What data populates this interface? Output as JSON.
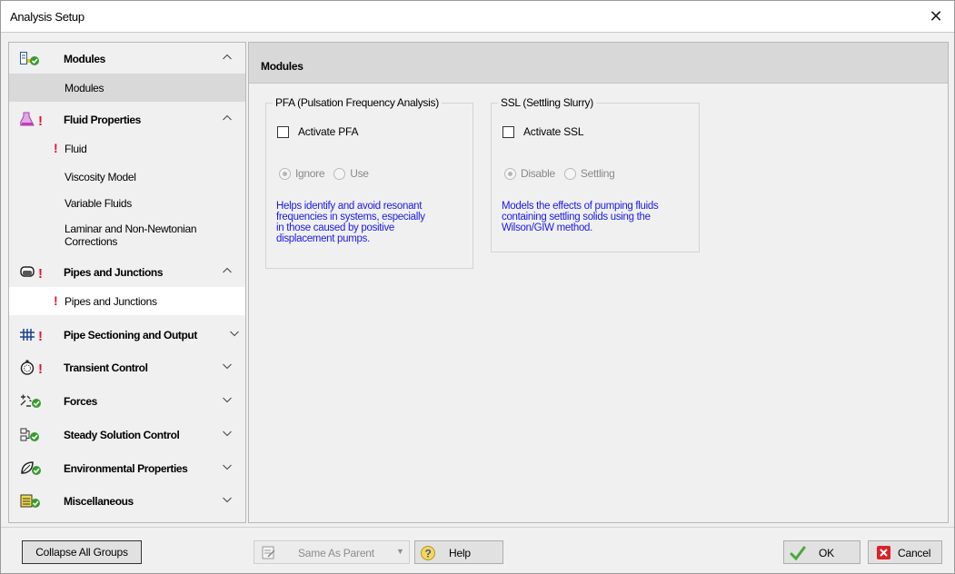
{
  "window": {
    "title": "Analysis Setup",
    "close_glyph": "✕"
  },
  "sidebar": {
    "groups": [
      {
        "label": "Modules",
        "icon": "modules-check-icon",
        "expanded": true,
        "items": [
          {
            "label": "Modules",
            "warning": false,
            "selected": true
          }
        ]
      },
      {
        "label": "Fluid Properties",
        "icon": "flask-warning-icon",
        "expanded": true,
        "items": [
          {
            "label": "Fluid",
            "warning": true
          },
          {
            "label": "Viscosity Model",
            "warning": false
          },
          {
            "label": "Variable Fluids",
            "warning": false
          },
          {
            "label": "Laminar and Non-Newtonian Corrections",
            "warning": false
          }
        ]
      },
      {
        "label": "Pipes and Junctions",
        "icon": "pipe-warning-icon",
        "expanded": true,
        "items": [
          {
            "label": "Pipes and Junctions",
            "warning": true
          }
        ]
      },
      {
        "label": "Pipe Sectioning and Output",
        "icon": "sectioning-warning-icon",
        "expanded": false
      },
      {
        "label": "Transient Control",
        "icon": "stopwatch-warning-icon",
        "expanded": false
      },
      {
        "label": "Forces",
        "icon": "forces-check-icon",
        "expanded": false
      },
      {
        "label": "Steady Solution Control",
        "icon": "solution-check-icon",
        "expanded": false
      },
      {
        "label": "Environmental Properties",
        "icon": "leaf-check-icon",
        "expanded": false
      },
      {
        "label": "Miscellaneous",
        "icon": "misc-check-icon",
        "expanded": false
      }
    ],
    "warning_glyph": "!"
  },
  "content": {
    "title": "Modules",
    "modules": [
      {
        "legend": "PFA (Pulsation Frequency Analysis)",
        "checkbox_label": "Activate PFA",
        "checked": false,
        "radio_options": [
          {
            "label": "Ignore",
            "selected": true
          },
          {
            "label": "Use",
            "selected": false
          }
        ],
        "description": [
          "Helps identify and avoid resonant",
          "frequencies in systems, especially",
          "in those caused by positive",
          "displacement pumps."
        ]
      },
      {
        "legend": "SSL (Settling Slurry)",
        "checkbox_label": "Activate SSL",
        "checked": false,
        "radio_options": [
          {
            "label": "Disable",
            "selected": true
          },
          {
            "label": "Settling",
            "selected": false
          }
        ],
        "description": [
          "Models the effects of pumping fluids",
          "containing settling solids using the",
          "Wilson/GIW method."
        ]
      }
    ]
  },
  "footer": {
    "collapse_label": "Collapse All Groups",
    "same_as_parent_label": "Same As Parent",
    "help_label": "Help",
    "ok_label": "OK",
    "cancel_label": "Cancel"
  },
  "colors": {
    "warning": "#e8112d",
    "description_text": "#1a1ae6",
    "check_green": "#3a9b2f",
    "selected_item_bg": "#d9d9d9",
    "header_bg": "#d8d8d8"
  }
}
